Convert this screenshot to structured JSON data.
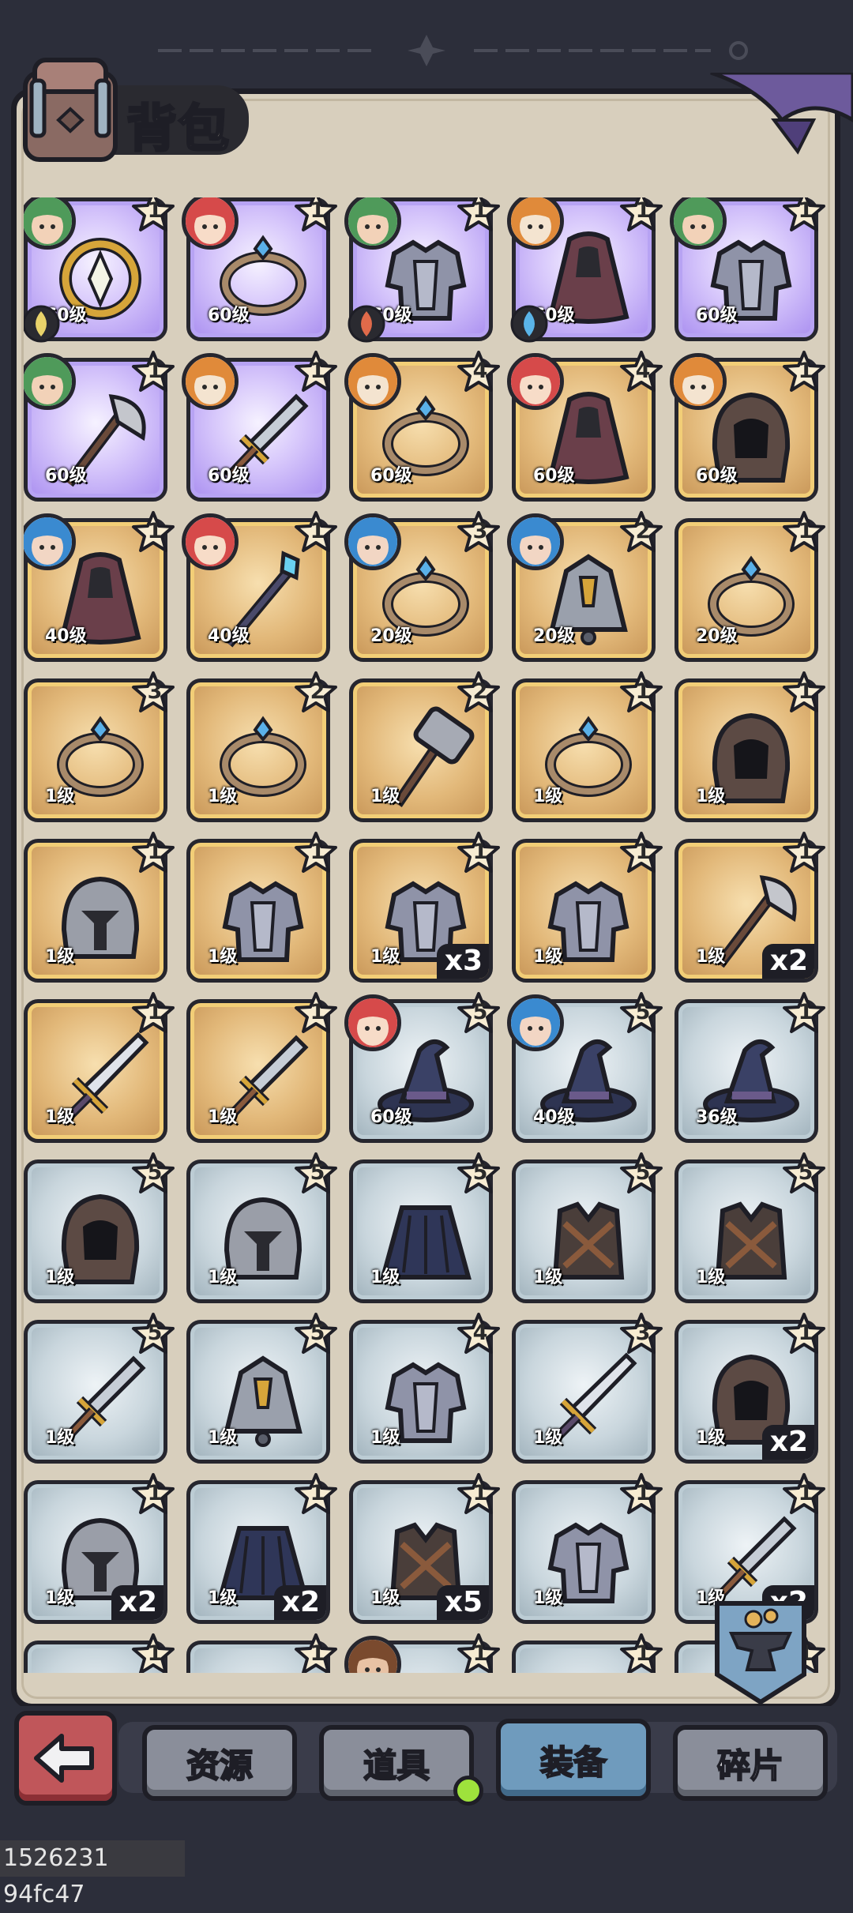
{
  "header": {
    "title": "背包"
  },
  "tabs": [
    {
      "label": "资源",
      "active": false
    },
    {
      "label": "道具",
      "active": false,
      "notify": true
    },
    {
      "label": "装备",
      "active": true
    },
    {
      "label": "碎片",
      "active": false
    }
  ],
  "watermark": "1526231 94fc47",
  "colors": {
    "purple": "#c4b1f6",
    "gold": "#e2b879",
    "blue": "#c9d6dd",
    "panel": "#d8cfbd",
    "active_tab": "#6f9bbd"
  },
  "items": [
    {
      "rarity": "purple",
      "icon": "amulet",
      "avatar": "green",
      "stars": "1",
      "level": "60级",
      "element": "earth"
    },
    {
      "rarity": "purple",
      "icon": "ring",
      "avatar": "red",
      "stars": "1",
      "level": "60级"
    },
    {
      "rarity": "purple",
      "icon": "armor",
      "avatar": "green",
      "stars": "1",
      "level": "60级",
      "element": "fire"
    },
    {
      "rarity": "purple",
      "icon": "cloak",
      "avatar": "tiger",
      "stars": "1",
      "level": "60级",
      "element": "water"
    },
    {
      "rarity": "purple",
      "icon": "armor",
      "avatar": "green",
      "stars": "1",
      "level": "60级"
    },
    {
      "rarity": "purple",
      "icon": "axe",
      "avatar": "green",
      "stars": "1",
      "level": "60级"
    },
    {
      "rarity": "purple",
      "icon": "dagger",
      "avatar": "tiger",
      "stars": "1",
      "level": "60级"
    },
    {
      "rarity": "gold",
      "icon": "ring",
      "avatar": "tiger",
      "stars": "4",
      "level": "60级"
    },
    {
      "rarity": "gold",
      "icon": "cloak",
      "avatar": "red",
      "stars": "4",
      "level": "60级"
    },
    {
      "rarity": "gold",
      "icon": "hood",
      "avatar": "tiger",
      "stars": "1",
      "level": "60级"
    },
    {
      "rarity": "gold",
      "icon": "cloak",
      "avatar": "blue",
      "stars": "1",
      "level": "40级"
    },
    {
      "rarity": "gold",
      "icon": "staff",
      "avatar": "red",
      "stars": "1",
      "level": "40级"
    },
    {
      "rarity": "gold",
      "icon": "ring",
      "avatar": "blue",
      "stars": "3",
      "level": "20级"
    },
    {
      "rarity": "gold",
      "icon": "bell",
      "avatar": "blue",
      "stars": "2",
      "level": "20级"
    },
    {
      "rarity": "gold",
      "icon": "ring",
      "stars": "1",
      "level": "20级"
    },
    {
      "rarity": "gold",
      "icon": "ring",
      "stars": "3",
      "level": "1级"
    },
    {
      "rarity": "gold",
      "icon": "ring",
      "stars": "2",
      "level": "1级"
    },
    {
      "rarity": "gold",
      "icon": "hammer",
      "stars": "2",
      "level": "1级"
    },
    {
      "rarity": "gold",
      "icon": "ring",
      "stars": "1",
      "level": "1级"
    },
    {
      "rarity": "gold",
      "icon": "hood",
      "stars": "1",
      "level": "1级"
    },
    {
      "rarity": "gold",
      "icon": "helmet",
      "stars": "1",
      "level": "1级"
    },
    {
      "rarity": "gold",
      "icon": "armor",
      "stars": "1",
      "level": "1级"
    },
    {
      "rarity": "gold",
      "icon": "armor",
      "stars": "1",
      "level": "1级",
      "qty": "x3"
    },
    {
      "rarity": "gold",
      "icon": "armor",
      "stars": "1",
      "level": "1级"
    },
    {
      "rarity": "gold",
      "icon": "axe",
      "stars": "1",
      "level": "1级",
      "qty": "x2"
    },
    {
      "rarity": "gold",
      "icon": "sword",
      "stars": "1",
      "level": "1级"
    },
    {
      "rarity": "gold",
      "icon": "dagger",
      "stars": "1",
      "level": "1级"
    },
    {
      "rarity": "blue",
      "icon": "hat",
      "avatar": "red",
      "stars": "5",
      "level": "60级"
    },
    {
      "rarity": "blue",
      "icon": "hat",
      "avatar": "blue",
      "stars": "5",
      "level": "40级"
    },
    {
      "rarity": "blue",
      "icon": "hat",
      "stars": "1",
      "level": "36级"
    },
    {
      "rarity": "blue",
      "icon": "hood",
      "stars": "5",
      "level": "1级"
    },
    {
      "rarity": "blue",
      "icon": "helmet",
      "stars": "5",
      "level": "1级"
    },
    {
      "rarity": "blue",
      "icon": "skirt",
      "stars": "5",
      "level": "1级"
    },
    {
      "rarity": "blue",
      "icon": "vest",
      "stars": "5",
      "level": "1级"
    },
    {
      "rarity": "blue",
      "icon": "vest",
      "stars": "5",
      "level": "1级"
    },
    {
      "rarity": "blue",
      "icon": "dagger",
      "stars": "5",
      "level": "1级"
    },
    {
      "rarity": "blue",
      "icon": "bell",
      "stars": "5",
      "level": "1级"
    },
    {
      "rarity": "blue",
      "icon": "armor",
      "stars": "4",
      "level": "1级"
    },
    {
      "rarity": "blue",
      "icon": "sword",
      "stars": "3",
      "level": "1级"
    },
    {
      "rarity": "blue",
      "icon": "hood",
      "stars": "1",
      "level": "1级",
      "qty": "x2"
    },
    {
      "rarity": "blue",
      "icon": "helmet",
      "stars": "1",
      "level": "1级",
      "qty": "x2"
    },
    {
      "rarity": "blue",
      "icon": "skirt",
      "stars": "1",
      "level": "1级",
      "qty": "x2"
    },
    {
      "rarity": "blue",
      "icon": "vest",
      "stars": "1",
      "level": "1级",
      "qty": "x5"
    },
    {
      "rarity": "blue",
      "icon": "armor",
      "stars": "1",
      "level": "1级"
    },
    {
      "rarity": "blue",
      "icon": "dagger",
      "stars": "1",
      "level": "1级",
      "qty": "x2"
    },
    {
      "rarity": "blue",
      "icon": "ring",
      "stars": "1"
    },
    {
      "rarity": "blue",
      "icon": "helmet",
      "stars": "1"
    },
    {
      "rarity": "blue",
      "icon": "armor",
      "avatar": "brown",
      "stars": "1"
    },
    {
      "rarity": "blue",
      "icon": "armor",
      "stars": "1"
    },
    {
      "rarity": "blue",
      "icon": "dagger",
      "stars": "1"
    }
  ]
}
